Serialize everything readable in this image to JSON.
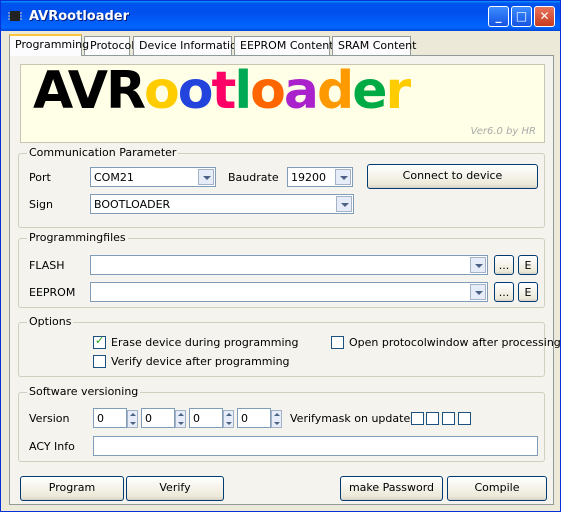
{
  "window": {
    "title": "AVRootloader"
  },
  "tabs": [
    "Programming",
    "Protocol",
    "Device Information",
    "EEPROM Content",
    "SRAM Content"
  ],
  "logo": {
    "text_av": "AV",
    "text_r": "R",
    "letters": [
      "o",
      "o",
      "t",
      "l",
      "o",
      "a",
      "d",
      "e",
      "r"
    ],
    "letter_colors": [
      "#ffcc00",
      "#2244dd",
      "#ff0066",
      "#00aa55",
      "#ff6600",
      "#aa22cc",
      "#ff9900",
      "#00aa44",
      "#ffcc00"
    ],
    "version": "Ver6.0 by HR"
  },
  "communication": {
    "label": "Communication Parameter",
    "port_label": "Port",
    "port_value": "COM21",
    "baud_label": "Baudrate",
    "baud_value": "19200",
    "sign_label": "Sign",
    "sign_value": "BOOTLOADER",
    "connect_label": "Connect to device"
  },
  "files": {
    "label": "Programmingfiles",
    "flash_label": "FLASH",
    "flash_value": "",
    "eeprom_label": "EEPROM",
    "eeprom_value": "",
    "browse_label": "...",
    "edit_label": "E"
  },
  "options": {
    "label": "Options",
    "erase_label": "Erase device during programming",
    "erase_checked": true,
    "verify_label": "Verify device after programming",
    "verify_checked": false,
    "protocol_label": "Open protocolwindow after processing",
    "protocol_checked": false
  },
  "versioning": {
    "label": "Software versioning",
    "version_label": "Version",
    "version_values": [
      "0",
      "0",
      "0",
      "0"
    ],
    "verifymask_label": "Verifymask on updates",
    "acy_label": "ACY Info",
    "acy_value": ""
  },
  "actions": {
    "program": "Program",
    "verify": "Verify",
    "password": "make Password",
    "compile": "Compile"
  }
}
